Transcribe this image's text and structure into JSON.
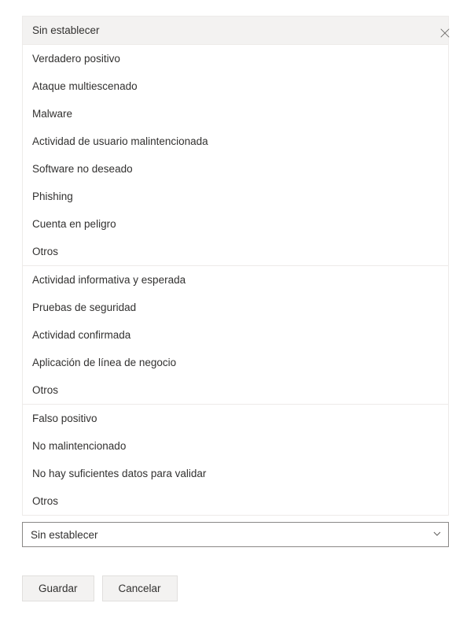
{
  "close_label": "Cerrar",
  "groups": [
    {
      "items": [
        {
          "label": "Sin establecer",
          "selected": true
        }
      ]
    },
    {
      "items": [
        {
          "label": "Verdadero positivo"
        },
        {
          "label": "Ataque multiescenado"
        },
        {
          "label": "Malware"
        },
        {
          "label": "Actividad de usuario malintencionada"
        },
        {
          "label": "Software no deseado"
        },
        {
          "label": "Phishing"
        },
        {
          "label": "Cuenta en peligro"
        },
        {
          "label": "Otros"
        }
      ]
    },
    {
      "items": [
        {
          "label": "Actividad informativa y esperada"
        },
        {
          "label": "Pruebas de seguridad"
        },
        {
          "label": "Actividad confirmada"
        },
        {
          "label": "Aplicación de línea de negocio"
        },
        {
          "label": "Otros"
        }
      ]
    },
    {
      "items": [
        {
          "label": "Falso positivo"
        },
        {
          "label": "No malintencionado"
        },
        {
          "label": "No hay suficientes datos para validar"
        },
        {
          "label": "Otros"
        }
      ]
    }
  ],
  "dropdown": {
    "value": "Sin establecer"
  },
  "buttons": {
    "save": "Guardar",
    "cancel": "Cancelar"
  }
}
